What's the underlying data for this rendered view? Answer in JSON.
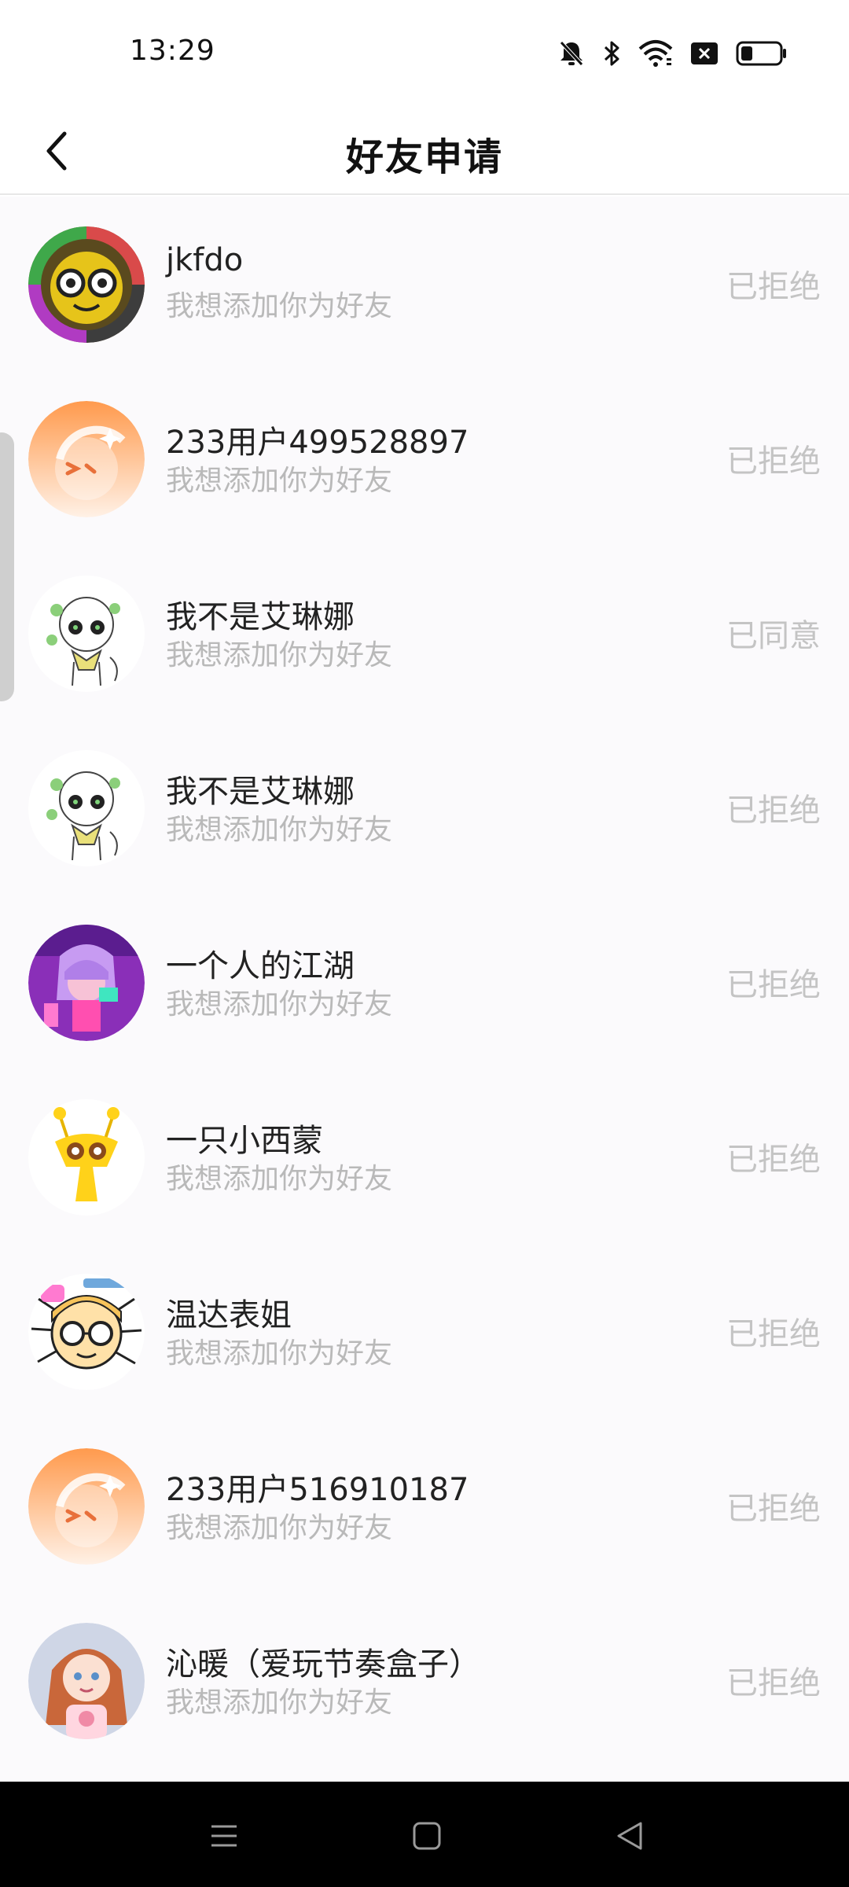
{
  "status_bar": {
    "time": "13:29",
    "icons": [
      "bell-muted-icon",
      "bluetooth-icon",
      "wifi-icon",
      "sim-blocked-icon",
      "battery-icon"
    ],
    "battery_level": 0.3
  },
  "header": {
    "title": "好友申请",
    "back_icon": "chevron-left-icon"
  },
  "colors": {
    "status_text": "#c4c4c4",
    "message_text": "#b9b9b9",
    "list_background": "#fbfafc"
  },
  "requests": [
    {
      "name": "jkfdo",
      "message": "我想添加你为好友",
      "status": "已拒绝",
      "avatar": "robot-ring-avatar"
    },
    {
      "name": "233用户499528897",
      "message": "我想添加你为好友",
      "status": "已拒绝",
      "avatar": "default-orange-avatar"
    },
    {
      "name": "我不是艾琳娜",
      "message": "我想添加你为好友",
      "status": "已同意",
      "avatar": "sketch-girl-avatar"
    },
    {
      "name": "我不是艾琳娜",
      "message": "我想添加你为好友",
      "status": "已拒绝",
      "avatar": "sketch-girl-avatar"
    },
    {
      "name": "一个人的江湖",
      "message": "我想添加你为好友",
      "status": "已拒绝",
      "avatar": "purple-anime-avatar"
    },
    {
      "name": "一只小西蒙",
      "message": "我想添加你为好友",
      "status": "已拒绝",
      "avatar": "yellow-creature-avatar"
    },
    {
      "name": "温达表姐",
      "message": "我想添加你为好友",
      "status": "已拒绝",
      "avatar": "glasses-cartoon-avatar"
    },
    {
      "name": "233用户516910187",
      "message": "我想添加你为好友",
      "status": "已拒绝",
      "avatar": "default-orange-avatar"
    },
    {
      "name": "沁暖（爱玩节奏盒子）",
      "message": "我想添加你为好友",
      "status": "已拒绝",
      "avatar": "redhair-girl-avatar"
    }
  ],
  "nav_bar": {
    "buttons": [
      "menu-icon",
      "home-icon",
      "back-triangle-icon"
    ]
  }
}
